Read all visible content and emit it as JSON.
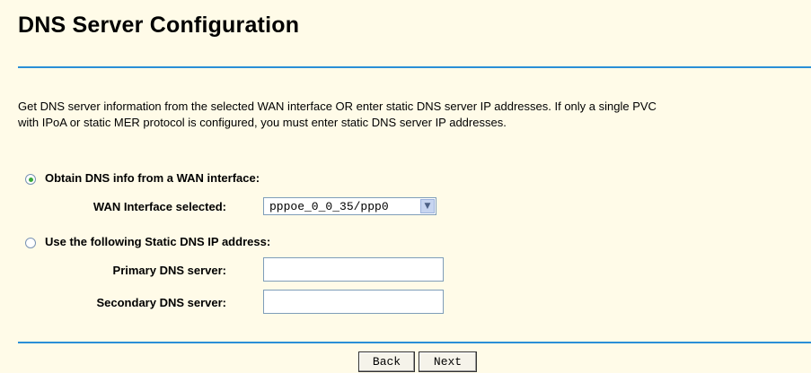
{
  "page": {
    "title": "DNS Server Configuration",
    "description_line1": "Get DNS server information from the selected WAN interface OR enter static DNS server IP addresses. If only a single PVC",
    "description_line2": "with IPoA or static MER protocol is configured, you must enter static DNS server IP addresses."
  },
  "options": {
    "obtain_label": "Obtain DNS info from a WAN interface:",
    "obtain_selected": true,
    "wan_interface_label": "WAN Interface selected:",
    "wan_interface_value": "pppoe_0_0_35/ppp0",
    "static_label": "Use the following Static DNS IP address:",
    "static_selected": false,
    "primary_label": "Primary DNS server:",
    "primary_value": "",
    "secondary_label": "Secondary DNS server:",
    "secondary_value": ""
  },
  "buttons": {
    "back": "Back",
    "next": "Next"
  },
  "colors": {
    "background": "#fffbe8",
    "rule": "#2a8fd6",
    "radio_dot": "#3aa83a"
  }
}
